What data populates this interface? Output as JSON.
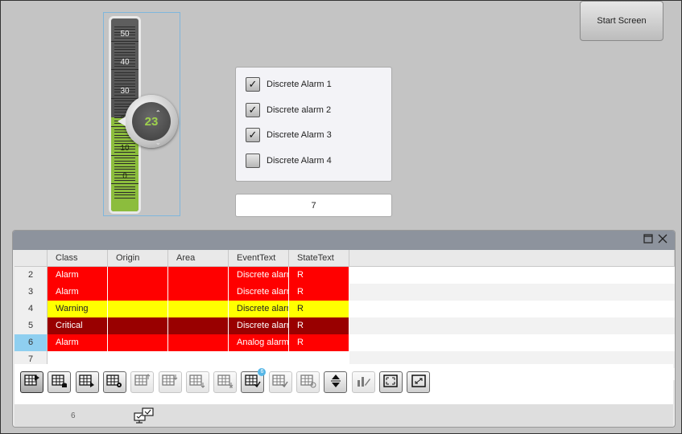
{
  "start_screen": {
    "label": "Start Screen"
  },
  "slider": {
    "value": "23",
    "value_number": 23,
    "min": 0,
    "max": 50,
    "scale_labels": [
      "50",
      "40",
      "30",
      "20",
      "10",
      "0"
    ],
    "fill_color": "#8cbd3d"
  },
  "alarms_checklist": [
    {
      "label": "Discrete Alarm 1",
      "checked": true
    },
    {
      "label": "Discrete alarm 2",
      "checked": true
    },
    {
      "label": "Discrete Alarm 3",
      "checked": true
    },
    {
      "label": "Discrete Alarm 4",
      "checked": false
    }
  ],
  "count_field": {
    "value": "7"
  },
  "alarm_view": {
    "columns": [
      "Class",
      "Origin",
      "Area",
      "EventText",
      "StateText"
    ],
    "rows": [
      {
        "num": "2",
        "class": "Alarm",
        "origin": "",
        "area": "",
        "event": "Discrete alarm",
        "state": "R",
        "bg": "#ff0000",
        "fg": "#ffffff"
      },
      {
        "num": "3",
        "class": "Alarm",
        "origin": "",
        "area": "",
        "event": "Discrete alarm",
        "state": "R",
        "bg": "#ff0000",
        "fg": "#ffffff"
      },
      {
        "num": "4",
        "class": "Warning",
        "origin": "",
        "area": "",
        "event": "Discrete alarm",
        "state": "R",
        "bg": "#ffff00",
        "fg": "#222222"
      },
      {
        "num": "5",
        "class": "Critical",
        "origin": "",
        "area": "",
        "event": "Discrete alarm",
        "state": "R",
        "bg": "#990000",
        "fg": "#ffffff"
      },
      {
        "num": "6",
        "class": "Alarm",
        "origin": "",
        "area": "",
        "event": "Analog alarm",
        "state": "R",
        "bg": "#ff0000",
        "fg": "#ffffff",
        "selected": true
      },
      {
        "num": "7",
        "class": "",
        "origin": "",
        "area": "",
        "event": "",
        "state": "",
        "bg": "#ffffff",
        "fg": "#222222"
      }
    ],
    "toolbar_badge": "6",
    "status_count": "6",
    "toolbar_buttons": [
      "current-alarms-icon",
      "alarm-buffer-icon",
      "alarm-log-icon",
      "alarm-settings-icon",
      "sort-ascending-icon",
      "sort-descending-icon",
      "scroll-down-icon",
      "scroll-end-icon",
      "acknowledge-icon",
      "single-acknowledge-icon",
      "loop-in-alarm-icon",
      "autoscroll-icon",
      "edit-alarm-icon",
      "fit-view-icon",
      "expand-view-icon"
    ]
  }
}
